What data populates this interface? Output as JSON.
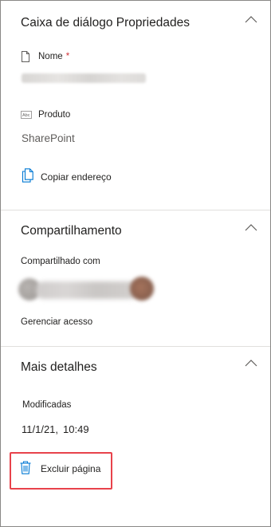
{
  "properties": {
    "title": "Caixa de diálogo Propriedades",
    "name_label": "Nome",
    "required_marker": "*",
    "product_label": "Produto",
    "product_value": "SharePoint",
    "copy_address_label": "Copiar endereço"
  },
  "sharing": {
    "title": "Compartilhamento",
    "shared_with_label": "Compartilhado com",
    "manage_access_label": "Gerenciar acesso"
  },
  "details": {
    "title": "Mais detalhes",
    "modified_label": "Modificadas",
    "modified_date": "11/1/21,",
    "modified_time": "10:49"
  },
  "delete_page_label": "Excluir página",
  "colors": {
    "accent": "#0078d4",
    "highlight_border": "#e8424b",
    "required": "#d13438"
  }
}
